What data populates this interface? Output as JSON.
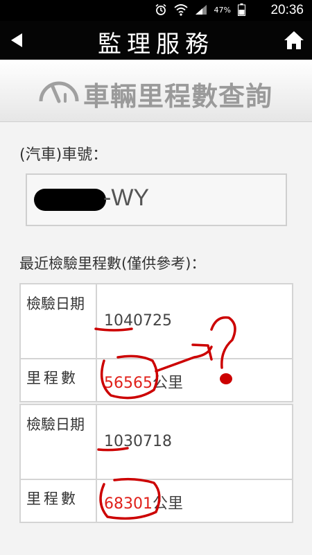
{
  "status_bar": {
    "battery_percent": "47%",
    "time": "20:36"
  },
  "header": {
    "title": "監理服務",
    "back_icon": "back-arrow-icon",
    "home_icon": "home-icon"
  },
  "banner": {
    "title": "車輛里程數查詢",
    "icon": "gauge-icon"
  },
  "plate": {
    "label": "(汽車)車號：",
    "value_suffix": "-WY"
  },
  "records_label": "最近檢驗里程數(僅供參考)：",
  "records": [
    {
      "date_label": "檢驗日期",
      "date": "1040725",
      "mileage_label": "里程數",
      "mileage": "56565",
      "unit": "公里"
    },
    {
      "date_label": "檢驗日期",
      "date": "1030718",
      "mileage_label": "里程數",
      "mileage": "68301",
      "unit": "公里"
    }
  ],
  "colors": {
    "header_bg": "#050505",
    "mileage_text": "#e0201a",
    "annotation": "#cc0000"
  }
}
